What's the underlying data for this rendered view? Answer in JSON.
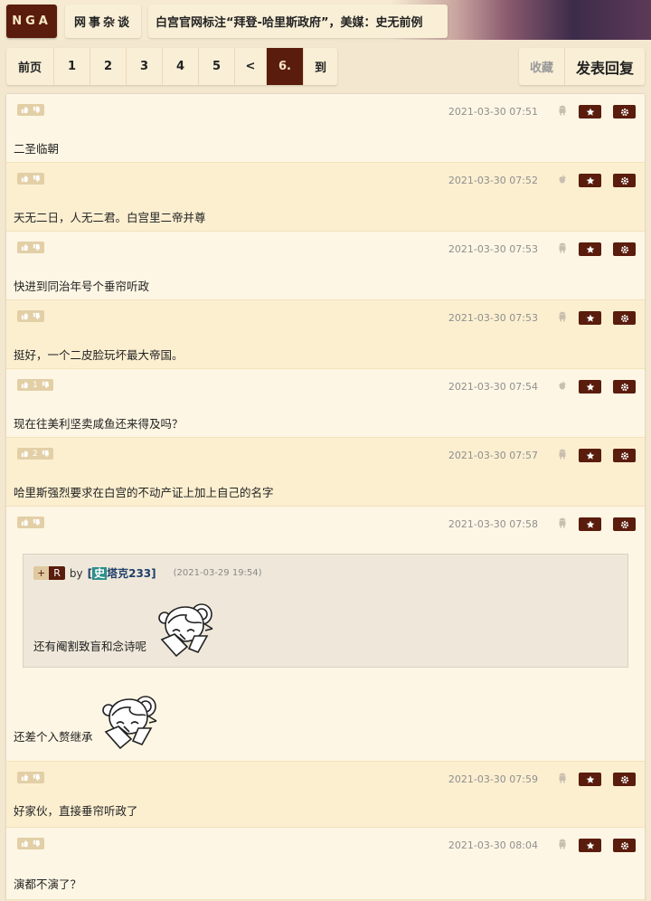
{
  "header": {
    "logo": "NGA",
    "forum": "网事杂谈",
    "title": "白宫官网标注“拜登-哈里斯政府”，美媒：史无前例"
  },
  "pager": {
    "items": [
      "前页",
      "1",
      "2",
      "3",
      "4",
      "5",
      "<",
      "6.",
      "到"
    ],
    "current": "6."
  },
  "actions": {
    "favorite": "收藏",
    "reply": "发表回复"
  },
  "colors": {
    "accent": "#5a1c0c",
    "row_light": "#fdf6e4",
    "row_dark": "#fcefd0"
  },
  "posts": [
    {
      "votes": "",
      "date": "2021-03-30 07:51",
      "device": "android-icon",
      "text": "二圣临朝"
    },
    {
      "votes": "",
      "date": "2021-03-30 07:52",
      "device": "apple-icon",
      "text": "天无二日，人无二君。白宫里二帝并尊"
    },
    {
      "votes": "",
      "date": "2021-03-30 07:53",
      "device": "android-icon",
      "text": "快进到同治年号个垂帘听政"
    },
    {
      "votes": "",
      "date": "2021-03-30 07:53",
      "device": "android-icon",
      "text": "挺好，一个二皮脸玩坏最大帝国。"
    },
    {
      "votes": "1",
      "date": "2021-03-30 07:54",
      "device": "apple-icon",
      "text": "现在往美利坚卖咸鱼还来得及吗？"
    },
    {
      "votes": "2",
      "date": "2021-03-30 07:57",
      "device": "android-icon",
      "text": "哈里斯强烈要求在白宫的不动产证上加上自己的名字"
    },
    {
      "votes": "",
      "date": "2021-03-30 07:58",
      "device": "android-icon",
      "text": "还差个入赘继承",
      "quote": {
        "plus": "+",
        "r": "R",
        "by": "by",
        "user_badge": "史",
        "user": "塔克233",
        "time": "(2021-03-29 19:54)",
        "text": "还有阉割致盲和念诗呢"
      }
    },
    {
      "votes": "",
      "date": "2021-03-30 07:59",
      "device": "android-icon",
      "text": "好家伙，直接垂帘听政了"
    },
    {
      "votes": "",
      "date": "2021-03-30 08:04",
      "device": "android-icon",
      "text": "演都不演了？"
    }
  ]
}
